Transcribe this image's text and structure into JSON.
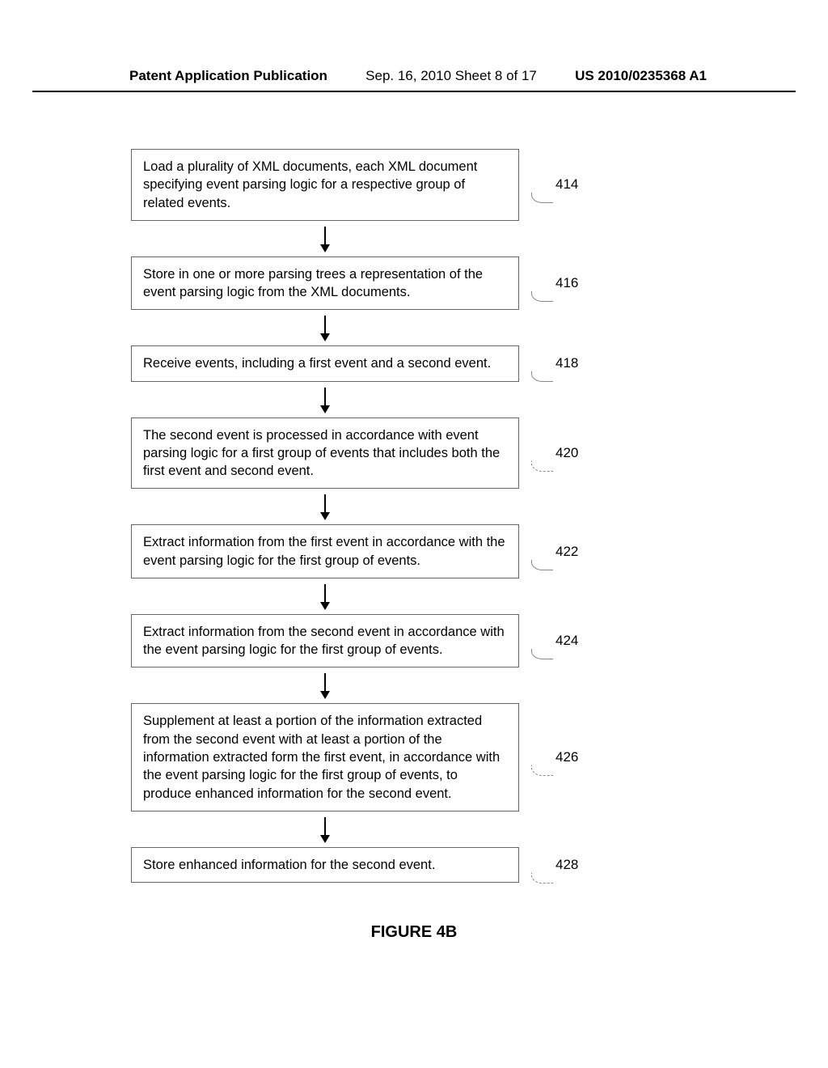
{
  "header": {
    "left": "Patent Application Publication",
    "center": "Sep. 16, 2010  Sheet 8 of 17",
    "right": "US 2010/0235368 A1"
  },
  "figure_label": "FIGURE 4B",
  "steps": [
    {
      "ref": "414",
      "text": "Load a plurality of XML documents, each XML document specifying event parsing logic for a respective group of related events."
    },
    {
      "ref": "416",
      "text": "Store in one or more parsing trees a representation of the event parsing logic from the XML documents."
    },
    {
      "ref": "418",
      "text": "Receive events, including a first event and a second event."
    },
    {
      "ref": "420",
      "text": "The second event is processed in accordance with event parsing logic for a first group of events that includes both the first event and second event."
    },
    {
      "ref": "422",
      "text": "Extract information from the first event in accordance with the event parsing logic for the first group of events."
    },
    {
      "ref": "424",
      "text": "Extract information from the second event in accordance with the event parsing logic for the first group of events."
    },
    {
      "ref": "426",
      "text": "Supplement at least a portion of the information extracted from the second event with at least a portion of the information extracted form the first event, in accordance with the event parsing logic for the first group of events, to produce enhanced information for the second event."
    },
    {
      "ref": "428",
      "text": "Store enhanced information for the second event."
    }
  ]
}
